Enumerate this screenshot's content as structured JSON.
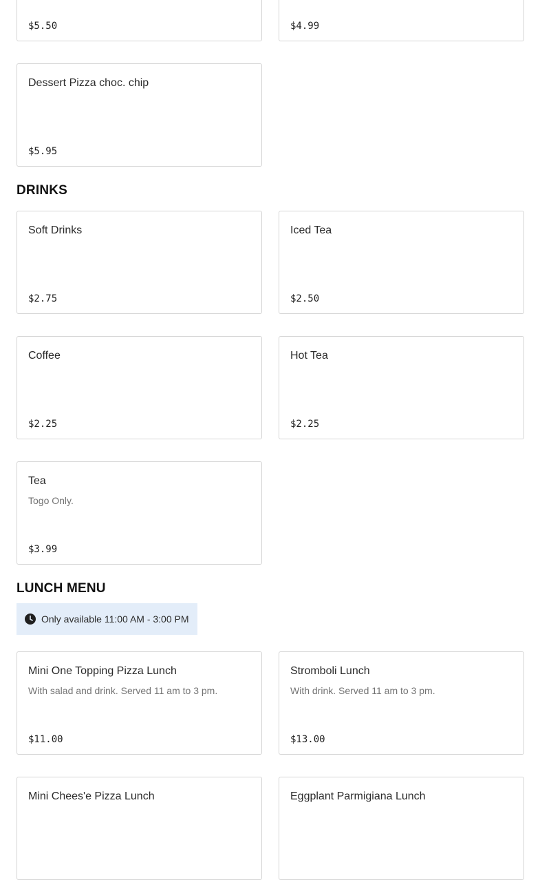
{
  "top_cards": [
    {
      "price": "$5.50"
    },
    {
      "price": "$4.99"
    }
  ],
  "desserts": [
    {
      "name": "Dessert Pizza choc. chip",
      "price": "$5.95"
    }
  ],
  "drinks": {
    "title": "DRINKS",
    "items": [
      {
        "name": "Soft Drinks",
        "price": "$2.75"
      },
      {
        "name": "Iced Tea",
        "price": "$2.50"
      },
      {
        "name": "Coffee",
        "price": "$2.25"
      },
      {
        "name": "Hot Tea",
        "price": "$2.25"
      },
      {
        "name": "Tea",
        "desc": "Togo Only.",
        "price": "$3.99"
      }
    ]
  },
  "lunch": {
    "title": "LUNCH MENU",
    "availability": "Only available 11:00 AM - 3:00 PM",
    "items": [
      {
        "name": "Mini One Topping Pizza Lunch",
        "desc": "With salad and drink. Served 11 am to 3 pm.",
        "price": "$11.00"
      },
      {
        "name": "Stromboli Lunch",
        "desc": "With drink. Served 11 am to 3 pm.",
        "price": "$13.00"
      },
      {
        "name": "Mini Chees'e Pizza Lunch"
      },
      {
        "name": "Eggplant Parmigiana Lunch"
      }
    ]
  },
  "icons": {
    "availability": "clock-icon"
  }
}
